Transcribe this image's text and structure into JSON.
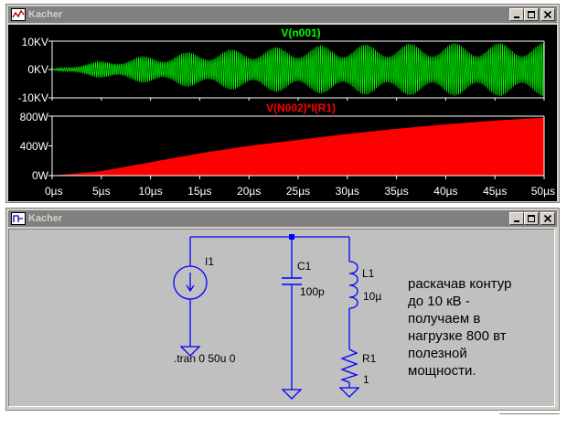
{
  "waveform_window": {
    "title": "Kacher",
    "top_plot": {
      "trace_label": "V(n001)",
      "trace_color": "#00ff00",
      "y_ticks": [
        "10KV",
        "0KV",
        "-10KV"
      ]
    },
    "bottom_plot": {
      "trace_label": "V(N002)*I(R1)",
      "trace_color": "#ff0000",
      "y_ticks": [
        "800W",
        "400W",
        "0W"
      ]
    },
    "x_ticks": [
      "0µs",
      "5µs",
      "10µs",
      "15µs",
      "20µs",
      "25µs",
      "30µs",
      "35µs",
      "40µs",
      "45µs",
      "50µs"
    ]
  },
  "schematic_window": {
    "title": "Kacher",
    "wire_color": "#0000ff",
    "source": {
      "name": "I1",
      "directive": ".tran 0 50u 0"
    },
    "capacitor": {
      "name": "C1",
      "value": "100p"
    },
    "inductor": {
      "name": "L1",
      "value": "10µ"
    },
    "resistor": {
      "name": "R1",
      "value": "1"
    },
    "note_lines": [
      "раскачав контур",
      "до 10 кВ -",
      "получаем в",
      "нагрузке 800 вт",
      "полезной",
      "мощности."
    ]
  },
  "chart_data": [
    {
      "type": "line",
      "title": "V(n001)",
      "x": [
        0,
        5,
        10,
        15,
        20,
        25,
        30,
        35,
        40,
        45,
        50
      ],
      "series": [
        {
          "name": "V(n001)",
          "envelope_kV": [
            0.2,
            3,
            5,
            6.5,
            7.5,
            8.3,
            8.8,
            9.1,
            9.3,
            9.4,
            9.5
          ]
        }
      ],
      "xlim": [
        0,
        50
      ],
      "ylim": [
        -10,
        10
      ]
    },
    {
      "type": "area",
      "title": "V(N002)*I(R1)",
      "x": [
        0,
        5,
        10,
        15,
        20,
        25,
        30,
        35,
        40,
        45,
        50
      ],
      "series": [
        {
          "name": "V(N002)*I(R1)",
          "values": [
            0,
            60,
            180,
            300,
            400,
            480,
            560,
            630,
            690,
            740,
            780
          ]
        }
      ],
      "xlim": [
        0,
        50
      ],
      "ylim": [
        0,
        800
      ]
    }
  ]
}
